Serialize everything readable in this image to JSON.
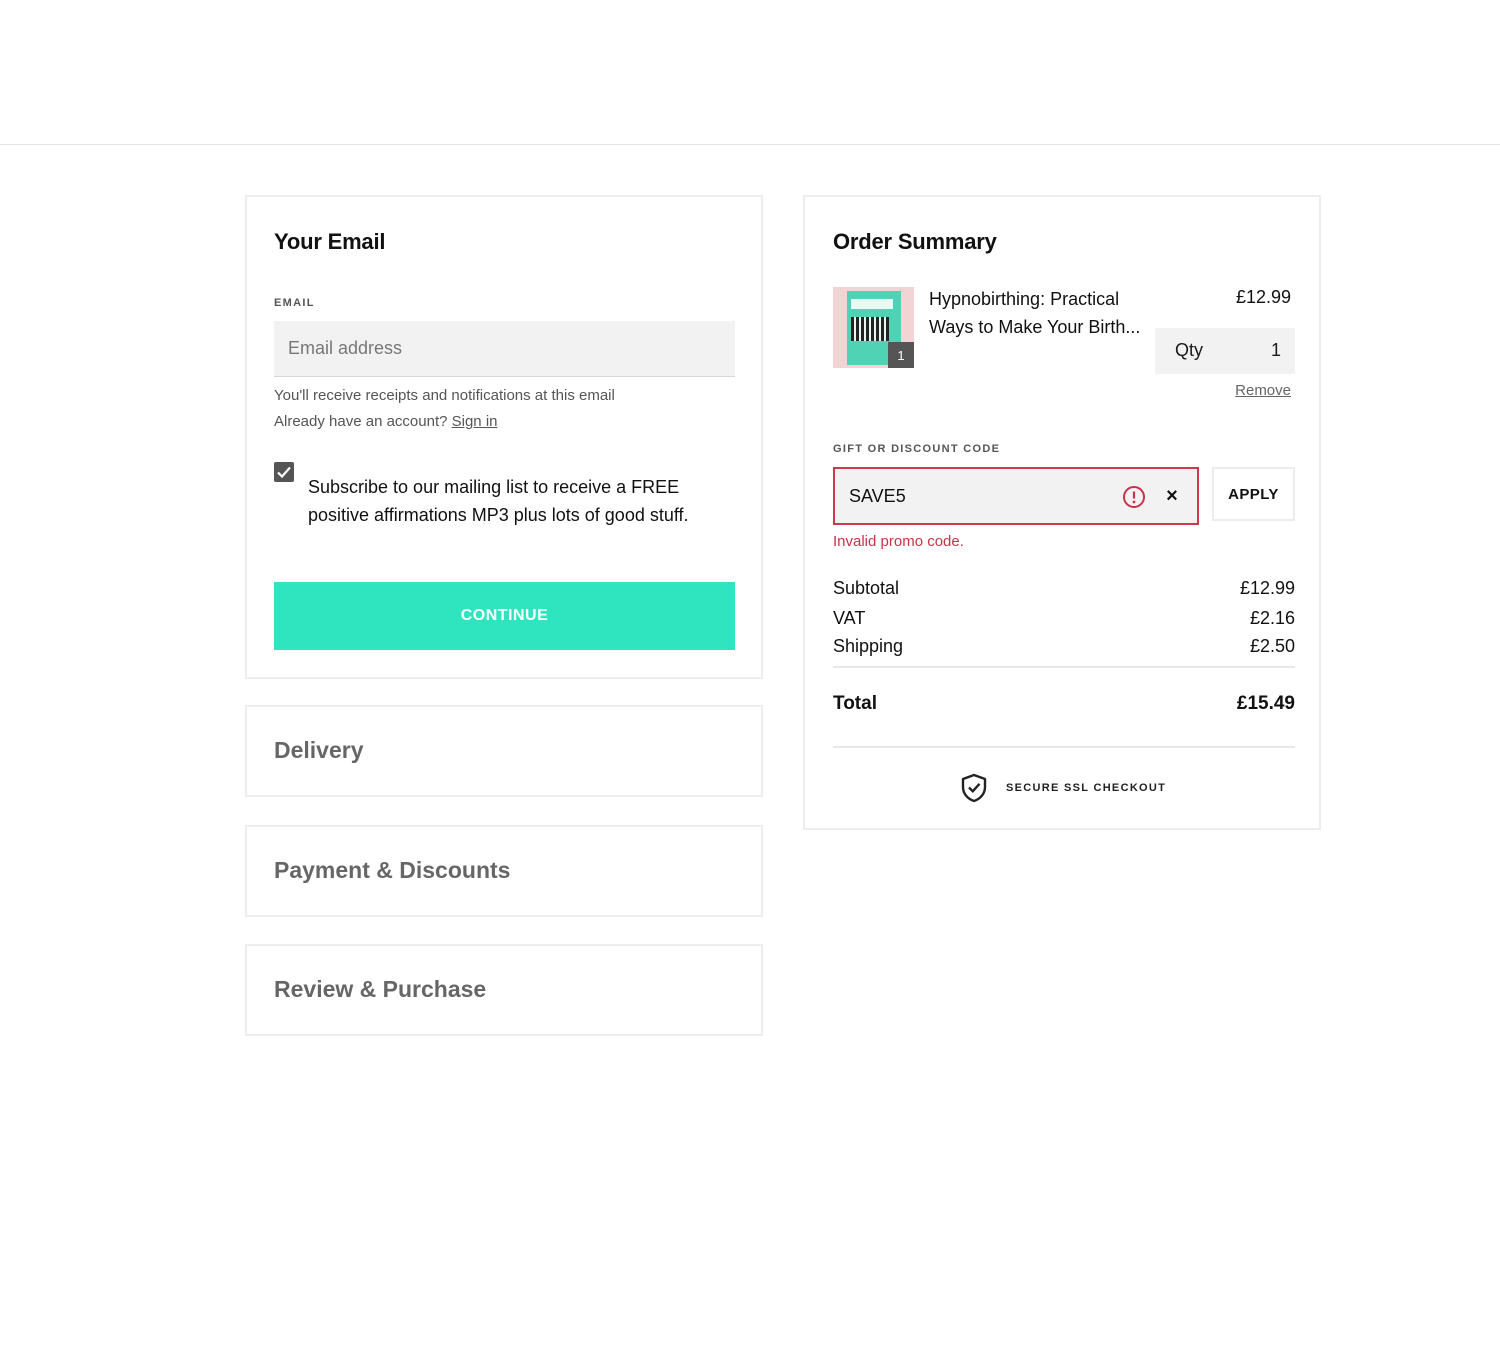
{
  "email_section": {
    "title": "Your Email",
    "field_label": "EMAIL",
    "placeholder": "Email address",
    "value": "",
    "helper_receipts": "You'll receive receipts and notifications at this email",
    "helper_account_prefix": "Already have an account?",
    "sign_in_label": "Sign in",
    "subscribe_checked": true,
    "subscribe_text": "Subscribe to our mailing list to receive a FREE positive affirmations MP3 plus lots of good stuff.",
    "continue_label": "CONTINUE"
  },
  "steps": [
    {
      "title": "Delivery"
    },
    {
      "title": "Payment & Discounts"
    },
    {
      "title": "Review & Purchase"
    }
  ],
  "order_summary": {
    "title": "Order Summary",
    "item": {
      "name": "Hypnobirthing: Practical Ways to Make Your Birth...",
      "price": "£12.99",
      "qty_label": "Qty",
      "qty": "1",
      "badge_qty": "1",
      "remove_label": "Remove"
    },
    "discount": {
      "label": "GIFT OR DISCOUNT CODE",
      "value": "SAVE5",
      "apply_label": "APPLY",
      "error": "Invalid promo code."
    },
    "lines": {
      "subtotal_label": "Subtotal",
      "subtotal": "£12.99",
      "vat_label": "VAT",
      "vat": "£2.16",
      "shipping_label": "Shipping",
      "shipping": "£2.50",
      "total_label": "Total",
      "total": "£15.49"
    },
    "secure_text": "SECURE SSL CHECKOUT"
  },
  "colors": {
    "accent": "#2ee5bf",
    "error": "#c8324a"
  }
}
